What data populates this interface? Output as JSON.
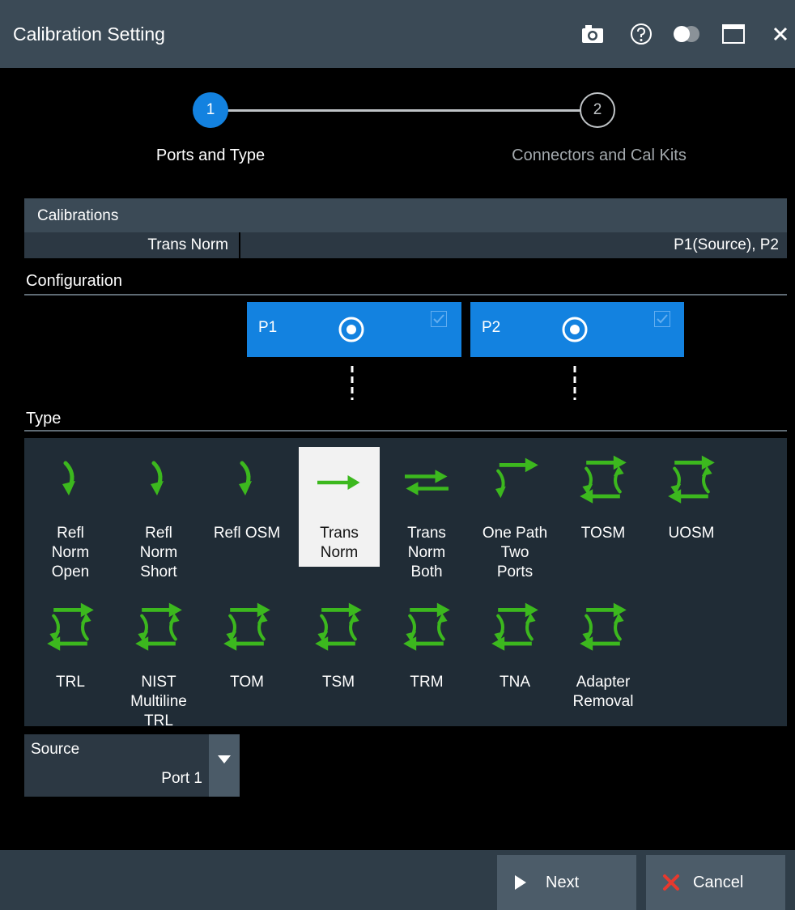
{
  "window": {
    "title": "Calibration Setting",
    "icons": [
      "camera-icon",
      "help-icon",
      "toggle-icon",
      "maximize-icon",
      "close-icon"
    ]
  },
  "stepper": {
    "steps": [
      {
        "number": "1",
        "label": "Ports and Type",
        "state": "active"
      },
      {
        "number": "2",
        "label": "Connectors and Cal Kits",
        "state": "inactive"
      }
    ]
  },
  "calibrations": {
    "header": "Calibrations",
    "row": {
      "type": "Trans Norm",
      "ports": "P1(Source), P2"
    }
  },
  "configuration": {
    "label": "Configuration",
    "ports": [
      {
        "name": "P1",
        "checked": true
      },
      {
        "name": "P2",
        "checked": true
      }
    ]
  },
  "type": {
    "label": "Type",
    "selected": "Trans Norm",
    "items": [
      {
        "label": "Refl\nNorm\nOpen",
        "icon": "refl-arrow-icon"
      },
      {
        "label": "Refl\nNorm\nShort",
        "icon": "refl-arrow-icon"
      },
      {
        "label": "Refl OSM",
        "icon": "refl-arrow-icon"
      },
      {
        "label": "Trans\nNorm",
        "icon": "trans-arrow-icon"
      },
      {
        "label": "Trans\nNorm\nBoth",
        "icon": "bidirectional-arrow-icon"
      },
      {
        "label": "One Path\nTwo\nPorts",
        "icon": "one-path-arrow-icon"
      },
      {
        "label": "TOSM",
        "icon": "full-two-port-icon"
      },
      {
        "label": "UOSM",
        "icon": "full-two-port-icon"
      },
      {
        "label": "TRL",
        "icon": "full-two-port-icon"
      },
      {
        "label": "NIST\nMultiline\nTRL",
        "icon": "full-two-port-icon"
      },
      {
        "label": "TOM",
        "icon": "full-two-port-icon"
      },
      {
        "label": "TSM",
        "icon": "full-two-port-icon"
      },
      {
        "label": "TRM",
        "icon": "full-two-port-icon"
      },
      {
        "label": "TNA",
        "icon": "full-two-port-icon"
      },
      {
        "label": "Adapter\nRemoval",
        "icon": "full-two-port-icon"
      }
    ]
  },
  "source": {
    "label": "Source",
    "value": "Port 1"
  },
  "footer": {
    "next_label": "Next",
    "cancel_label": "Cancel"
  },
  "colors": {
    "accent_blue": "#1382e0",
    "arrow_green": "#3cb81e",
    "cancel_red": "#e8392e",
    "titlebar": "#3b4a56"
  }
}
